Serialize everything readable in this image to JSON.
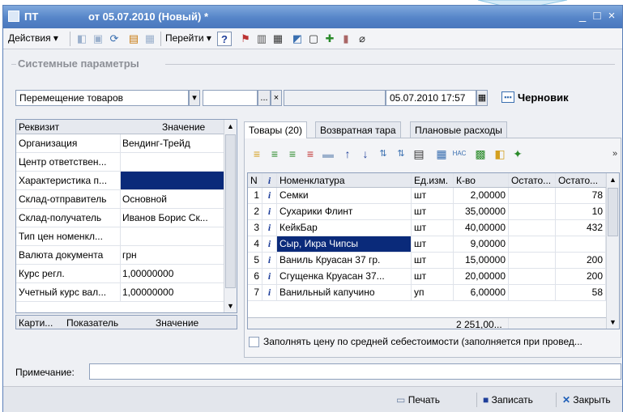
{
  "window": {
    "title": "ПТ",
    "subtitle": "от 05.07.2010 (Новый) *",
    "minimize_glyph": "_",
    "maximize_glyph": "□",
    "close_glyph": "×"
  },
  "toolbar": {
    "actions_label": "Действия ▾",
    "goto_label": "Перейти ▾",
    "help_label": "?"
  },
  "system_params": {
    "group_label": "Системные параметры",
    "operation_value": "Перемещение товаров",
    "dropdown_glyph": "▾",
    "ellipsis_glyph": "...",
    "clear_glyph": "×",
    "datetime_value": "05.07.2010 17:57",
    "status_label": "Черновик"
  },
  "props": {
    "header_key": "Реквизит",
    "header_value": "Значение",
    "rows": [
      {
        "key": "Организация",
        "value": "Вендинг-Трейд"
      },
      {
        "key": "Центр ответствен...",
        "value": ""
      },
      {
        "key": "Характеристика п...",
        "value": ""
      },
      {
        "key": "Склад-отправитель",
        "value": "Основной"
      },
      {
        "key": "Склад-получатель",
        "value": "Иванов Борис Ск..."
      },
      {
        "key": "Тип цен номенкл...",
        "value": ""
      },
      {
        "key": "Валюта документа",
        "value": "грн"
      },
      {
        "key": "Курс регл.",
        "value": "1,00000000"
      },
      {
        "key": "Учетный курс вал...",
        "value": "1,00000000"
      }
    ],
    "footer_cols": [
      "Карти...",
      "Показатель",
      "Значение"
    ]
  },
  "tabs": [
    {
      "label": "Товары (20)"
    },
    {
      "label": "Возвратная тара"
    },
    {
      "label": "Плановые расходы"
    }
  ],
  "grid": {
    "columns": [
      "N",
      "i",
      "Номенклатура",
      "Ед.изм.",
      "К-во",
      "Остато...",
      "Остато..."
    ],
    "rows": [
      {
        "n": "1",
        "info": "i",
        "name": "Семки",
        "unit": "шт",
        "qty": "2,00000",
        "rest1": "",
        "rest2": "78"
      },
      {
        "n": "2",
        "info": "i",
        "name": "Сухарики Флинт",
        "unit": "шт",
        "qty": "35,00000",
        "rest1": "",
        "rest2": "10"
      },
      {
        "n": "3",
        "info": "i",
        "name": "КейкБар",
        "unit": "шт",
        "qty": "40,00000",
        "rest1": "",
        "rest2": "432"
      },
      {
        "n": "4",
        "info": "i",
        "name": "Сыр, Икра Чипсы",
        "unit": "шт",
        "qty": "9,00000",
        "rest1": "",
        "rest2": ""
      },
      {
        "n": "5",
        "info": "i",
        "name": "Ваниль Круасан 37 гр.",
        "unit": "шт",
        "qty": "15,00000",
        "rest1": "",
        "rest2": "200"
      },
      {
        "n": "6",
        "info": "i",
        "name": "Сгущенка Круасан 37...",
        "unit": "шт",
        "qty": "20,00000",
        "rest1": "",
        "rest2": "200"
      },
      {
        "n": "7",
        "info": "i",
        "name": "Ванильный капучино",
        "unit": "уп",
        "qty": "6,00000",
        "rest1": "",
        "rest2": "58"
      }
    ],
    "total_qty": "2 251,00...",
    "fill_price_label": "Заполнять цену по средней себестоимости (заполняется при провед..."
  },
  "note": {
    "label": "Примечание:",
    "value": ""
  },
  "bottom": {
    "print_label": "Печать",
    "save_label": "Записать",
    "close_label": "Закрыть"
  },
  "colors": {
    "titlebar": "#5584c8",
    "selection": "#0a2a7a",
    "info_icon": "#1f3f9a"
  }
}
